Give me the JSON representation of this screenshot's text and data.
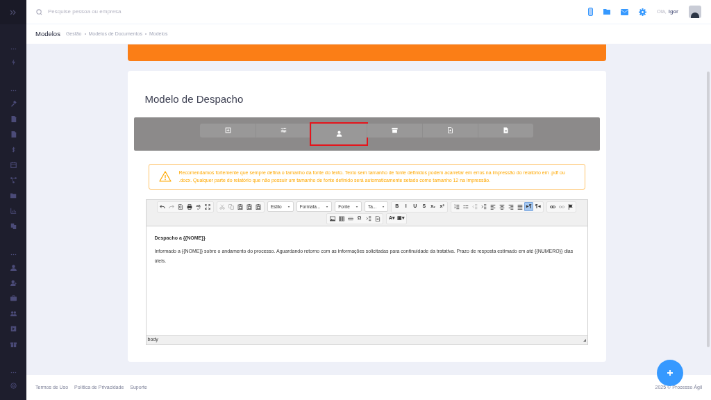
{
  "header": {
    "search": {
      "placeholder": "Pesquise pessoa ou empresa"
    },
    "greeting": "Olá,",
    "user_name": "Igor"
  },
  "subheader": {
    "title": "Modelos",
    "breadcrumb": [
      "Gestão",
      "Modelos de Documentos",
      "Modelos"
    ]
  },
  "page": {
    "title": "Modelo de Despacho",
    "tabs": [
      {
        "kind": "enter",
        "selected": false
      },
      {
        "kind": "sliders",
        "selected": false
      },
      {
        "kind": "user",
        "selected": true
      },
      {
        "kind": "archive",
        "selected": false
      },
      {
        "kind": "pdf",
        "selected": false
      },
      {
        "kind": "doc",
        "selected": false
      }
    ],
    "warning": "Recomendamos fortemente que sempre defina o tamanho da fonte do texto. Texto sem tamanho de fonte definidos podem acarretar em erros na impressão do relatório em .pdf ou .docx. Qualquer parte do relatório que não possuir um tamanho de fonte definido será automaticamente setado como tamanho 12 na impressão.",
    "editor": {
      "toolbar_rows": [
        [
          {
            "kind": "group",
            "buttons": [
              {
                "kind": "undo",
                "active": false
              },
              {
                "kind": "redo",
                "active": false
              },
              {
                "kind": "preview",
                "active": false
              },
              {
                "kind": "print",
                "active": false
              },
              {
                "kind": "spell",
                "active": false
              },
              {
                "kind": "maximize",
                "active": false
              }
            ]
          },
          {
            "kind": "group",
            "buttons": [
              {
                "kind": "cut",
                "active": false
              },
              {
                "kind": "copy",
                "active": false
              },
              {
                "kind": "paste",
                "active": false
              },
              {
                "kind": "paste",
                "active": false
              },
              {
                "kind": "paste",
                "active": false
              }
            ]
          },
          {
            "kind": "select",
            "label": "Estilo"
          },
          {
            "kind": "select",
            "label": "Formata..."
          },
          {
            "kind": "select",
            "label": "Fonte"
          },
          {
            "kind": "select",
            "label": "Ta..."
          },
          {
            "kind": "group",
            "buttons": [
              {
                "text": "B",
                "active": false
              },
              {
                "text": "I",
                "active": false
              },
              {
                "text": "U",
                "active": false
              },
              {
                "text": "S",
                "active": false
              },
              {
                "text": "x₂",
                "active": false
              },
              {
                "text": "x²",
                "active": false
              }
            ]
          },
          {
            "kind": "group",
            "buttons": [
              {
                "kind": "ol",
                "active": false
              },
              {
                "kind": "ul",
                "active": false
              },
              {
                "kind": "outdent",
                "active": false
              },
              {
                "kind": "indent",
                "active": false
              },
              {
                "kind": "left",
                "active": false
              },
              {
                "kind": "center",
                "active": false
              },
              {
                "kind": "right",
                "active": false
              },
              {
                "kind": "justify",
                "active": false
              },
              {
                "text": "▸¶",
                "active": true
              },
              {
                "text": "¶◂",
                "active": false
              }
            ]
          },
          {
            "kind": "group",
            "buttons": [
              {
                "kind": "link",
                "active": false
              },
              {
                "kind": "unlink",
                "active": false
              },
              {
                "kind": "flag",
                "active": false
              }
            ]
          }
        ],
        [
          {
            "kind": "group",
            "buttons": [
              {
                "kind": "image",
                "active": false
              },
              {
                "kind": "table",
                "active": false
              },
              {
                "kind": "hr",
                "active": false
              },
              {
                "text": "Ω",
                "active": false
              },
              {
                "kind": "indent",
                "active": false
              },
              {
                "kind": "doc",
                "active": false
              }
            ]
          },
          {
            "kind": "group",
            "buttons": [
              {
                "text": "A▾",
                "active": false
              },
              {
                "text": "▣▾",
                "active": false
              }
            ]
          }
        ]
      ],
      "heading": "Despacho a {{NOME}}",
      "body": "Informado a {{NOME}} sobre o andamento do processo. Aguardando retorno com as informações solicitadas para continuidade da tratativa. Prazo de resposta estimado em até {{NUMERO}} dias úteis.",
      "status_path": "body"
    }
  },
  "footer": {
    "links": [
      "Termos de Uso",
      "Política de Privacidade",
      "Suporte"
    ],
    "copyright": "2025 © Processo Ágil"
  }
}
